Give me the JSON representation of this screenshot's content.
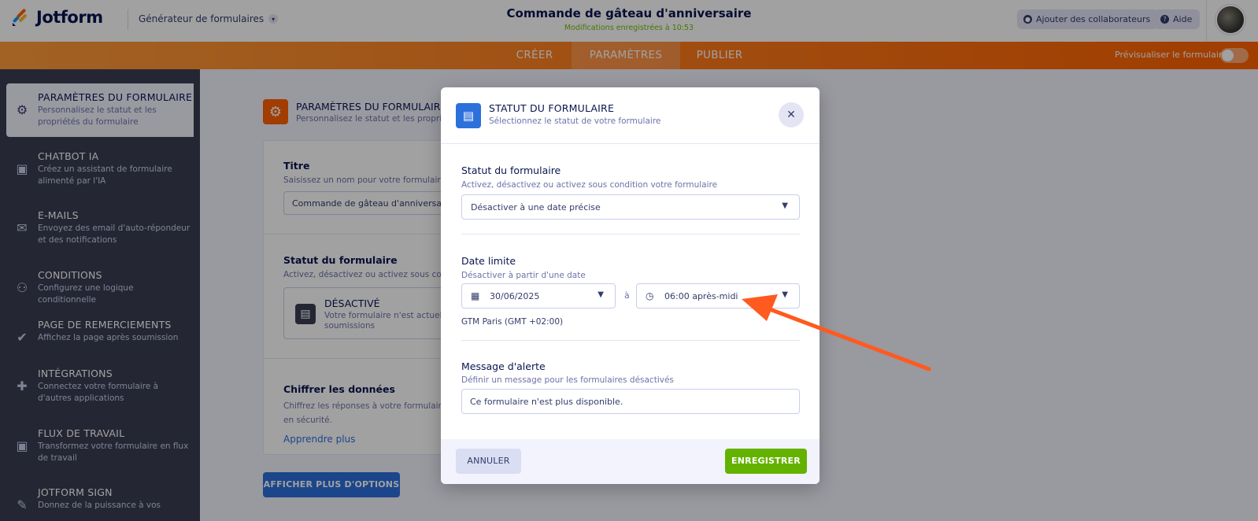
{
  "header": {
    "brand": "Jotform",
    "builder_label": "Générateur de formulaires",
    "form_title": "Commande de gâteau d'anniversaire",
    "save_status": "Modifications enregistrées à 10:53",
    "add_collaborators": "Ajouter des collaborateurs",
    "help": "Aide"
  },
  "nav": {
    "tabs": [
      {
        "label": "CRÉER",
        "active": false
      },
      {
        "label": "PARAMÈTRES",
        "active": true
      },
      {
        "label": "PUBLIER",
        "active": false
      }
    ],
    "preview_label": "Prévisualiser le formulaire",
    "preview_enabled": false
  },
  "sidebar": {
    "items": [
      {
        "title": "PARAMÈTRES DU FORMULAIRE",
        "desc": "Personnalisez le statut et les propriétés du formulaire",
        "icon": "gear-icon",
        "active": true
      },
      {
        "title": "CHATBOT IA",
        "desc": "Créez un assistant de formulaire alimenté par l'IA",
        "icon": "robot-icon",
        "active": false
      },
      {
        "title": "E-MAILS",
        "desc": "Envoyez des email d'auto-répondeur et des notifications",
        "icon": "envelope-icon",
        "active": false
      },
      {
        "title": "CONDITIONS",
        "desc": "Configurez une logique conditionnelle",
        "icon": "hierarchy-icon",
        "active": false
      },
      {
        "title": "PAGE DE REMERCIEMENTS",
        "desc": "Affichez la page après soumission",
        "icon": "check-circle-icon",
        "active": false
      },
      {
        "title": "INTÉGRATIONS",
        "desc": "Connectez votre formulaire à d'autres applications",
        "icon": "puzzle-icon",
        "active": false
      },
      {
        "title": "FLUX DE TRAVAIL",
        "desc": "Transformez votre formulaire en flux de travail",
        "icon": "workflow-icon",
        "active": false
      },
      {
        "title": "JOTFORM SIGN",
        "desc": "Donnez de la puissance à vos",
        "icon": "pen-icon",
        "active": false
      }
    ]
  },
  "main": {
    "section_title": "PARAMÈTRES DU FORMULAIRE",
    "section_sub": "Personnalisez le statut et les propriét",
    "title_label": "Titre",
    "title_help": "Saisissez un nom pour votre formulaire",
    "title_value": "Commande de gâteau d'anniversaire",
    "status_label": "Statut du formulaire",
    "status_help": "Activez, désactivez ou activez sous conc",
    "status_value": "DÉSACTIVÉ",
    "status_desc": "Votre formulaire n'est actuell soumissions",
    "encrypt_label": "Chiffrer les données",
    "encrypt_help_1": "Chiffrez les réponses à votre formulaire",
    "encrypt_help_2": "en sécurité.",
    "learn_more": "Apprendre plus",
    "more_options": "AFFICHER PLUS D'OPTIONS"
  },
  "modal": {
    "title": "STATUT DU FORMULAIRE",
    "subtitle": "Sélectionnez le statut de votre formulaire",
    "status_label": "Statut du formulaire",
    "status_help": "Activez, désactivez ou activez sous condition votre formulaire",
    "status_select": "Désactiver à une date précise",
    "deadline_label": "Date limite",
    "deadline_help": "Désactiver à partir d'une date",
    "date_value": "30/06/2025",
    "at": "à",
    "time_value": "06:00 après-midi",
    "timezone": "GTM Paris (GMT +02:00)",
    "alert_label": "Message d'alerte",
    "alert_help": "Définir un message pour les formulaires désactivés",
    "alert_value": "Ce formulaire n'est plus disponible.",
    "cancel": "ANNULER",
    "save": "ENREGISTRER"
  },
  "colors": {
    "accent_orange": "#ff6100",
    "primary_blue": "#2c70dc",
    "save_green": "#64b200",
    "annotation_arrow": "#ff5a1f"
  }
}
